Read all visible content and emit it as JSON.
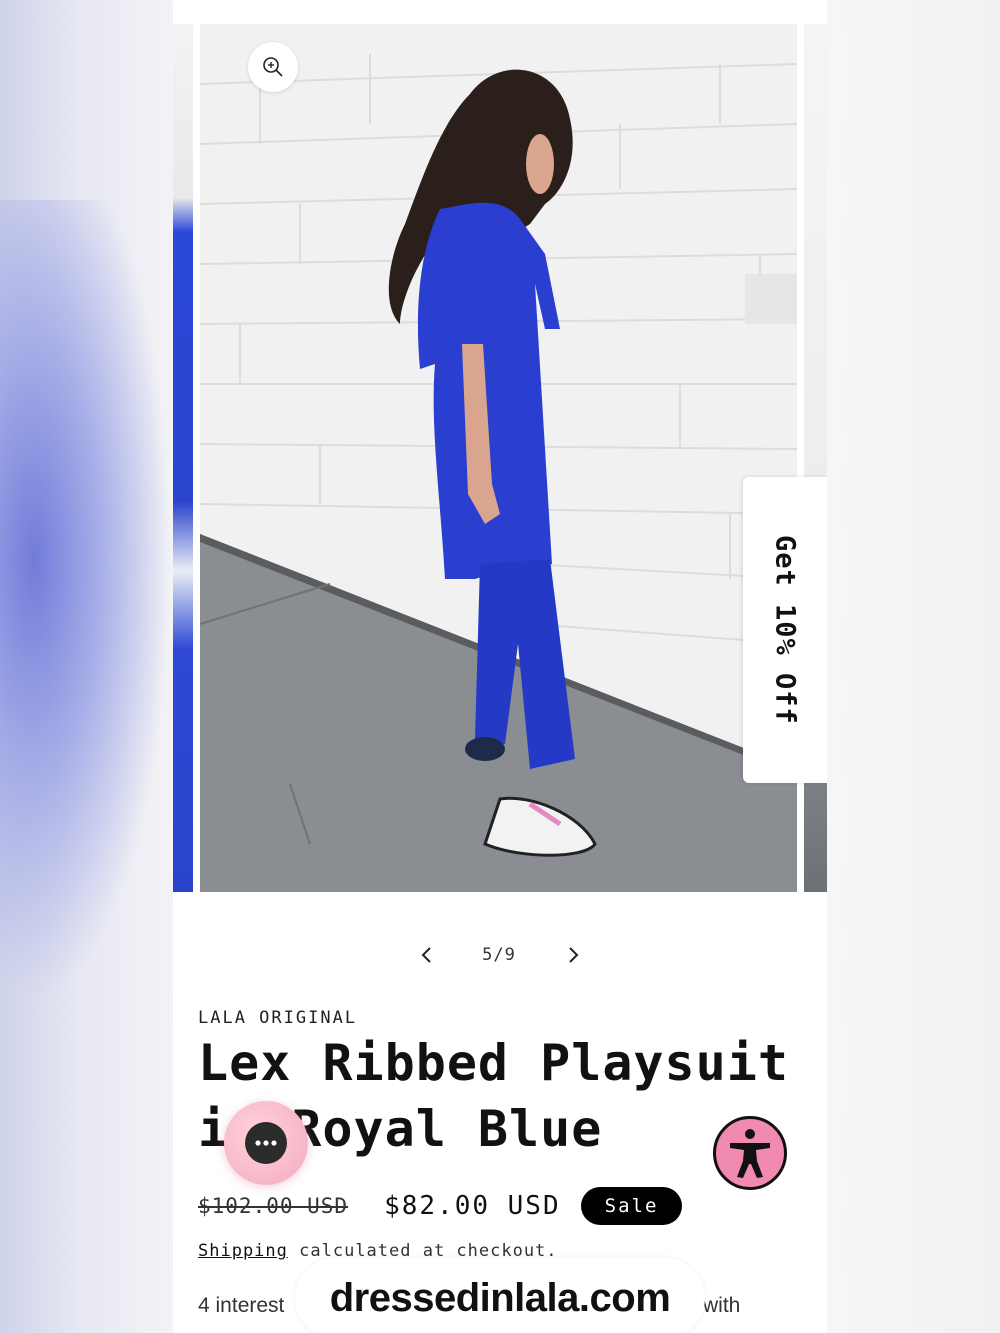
{
  "gallery": {
    "photo_alt": "Model wearing royal blue oversized top and wide-leg pants against a white brick wall",
    "current": "5/9",
    "zoom_icon": "zoom-in-icon",
    "prev_icon": "chevron-left-icon",
    "next_icon": "chevron-right-icon"
  },
  "promo": {
    "label": "Get 10% Off"
  },
  "product": {
    "vendor": "LALA ORIGINAL",
    "title": "Lex Ribbed Playsuit in Royal Blue",
    "price_regular": "$102.00 USD",
    "price_sale": "$82.00 USD",
    "sale_badge": "Sale",
    "shipping_link": "Shipping",
    "shipping_rest": " calculated at checkout.",
    "installments_start": "4 interest",
    "installments_end": "with"
  },
  "chat": {
    "icon": "chat-bubble-icon"
  },
  "accessibility": {
    "icon": "accessibility-icon"
  },
  "watermark": {
    "text": "dressedinlala.com"
  },
  "colors": {
    "royal_blue": "#2a3fd0",
    "sale_badge": "#000000",
    "chat_pink": "#f7b6c6",
    "accessibility_pink": "#f08ab0"
  }
}
